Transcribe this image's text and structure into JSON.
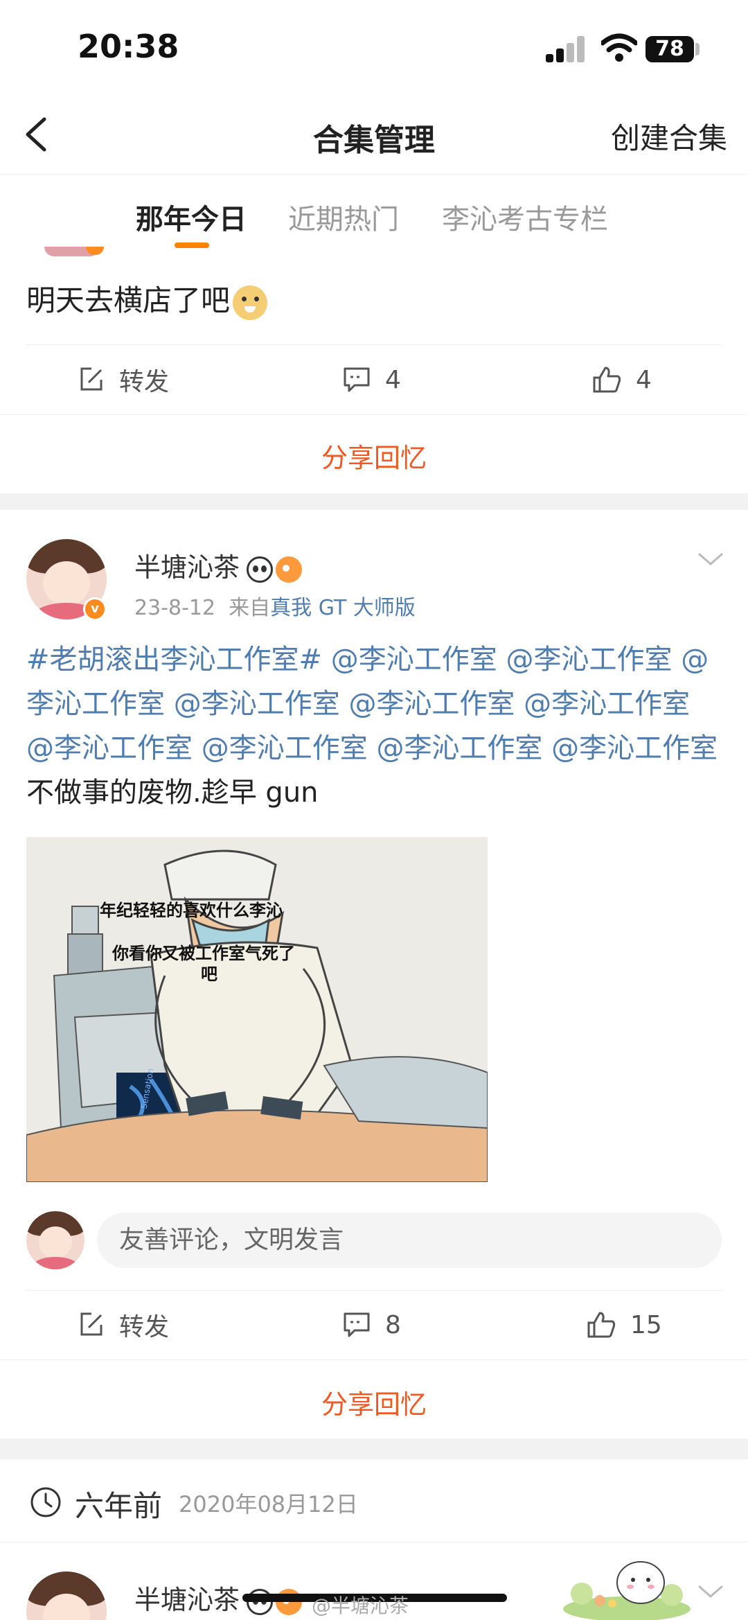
{
  "status_bar": {
    "time": "20:38",
    "battery": "78"
  },
  "navbar": {
    "title": "合集管理",
    "create_label": "创建合集"
  },
  "tabs": [
    {
      "label": "那年今日",
      "active": true
    },
    {
      "label": "近期热门",
      "active": false
    },
    {
      "label": "李沁考古专栏",
      "active": false
    }
  ],
  "post1": {
    "text": "明天去横店了吧",
    "repost_label": "转发",
    "comment_count": "4",
    "like_count": "4",
    "share_label": "分享回忆"
  },
  "post2": {
    "username": "半塘沁茶",
    "date": "23-8-12",
    "source_prefix": "来自",
    "device": "真我 GT 大师版",
    "hashtag": "#老胡滚出李沁工作室#",
    "mention": "@李沁工作室",
    "mention_count": 10,
    "tail_text": "不做事的废物.趁早 gun",
    "meme_texts": [
      "年纪轻轻的喜欢什么李沁",
      "你看你又被工作室气死了",
      "吧"
    ],
    "meme_badge": "Sensation",
    "comment_placeholder": "友善评论，文明发言",
    "repost_label": "转发",
    "comment_count": "8",
    "like_count": "15",
    "share_label": "分享回忆"
  },
  "section": {
    "years_ago": "六年前",
    "date": "2020年08月12日"
  },
  "post3": {
    "username": "半塘沁茶"
  },
  "watermark": "@半塘沁茶",
  "colors": {
    "accent": "#ff8200",
    "link": "#507daf",
    "share": "#f25822"
  }
}
